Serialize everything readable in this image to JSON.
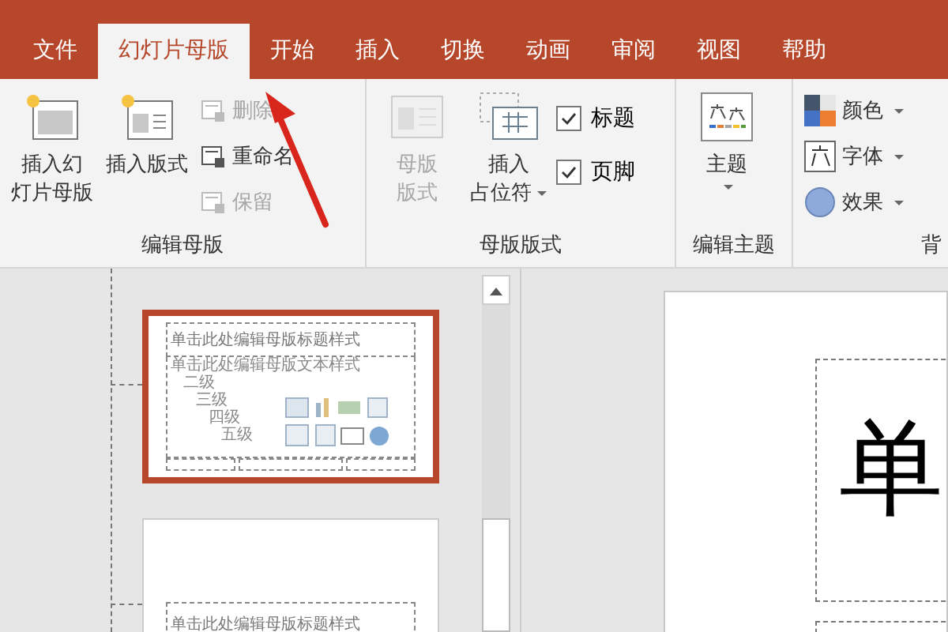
{
  "tabs": [
    {
      "label": "文件",
      "selected": false
    },
    {
      "label": "幻灯片母版",
      "selected": true
    },
    {
      "label": "开始",
      "selected": false
    },
    {
      "label": "插入",
      "selected": false
    },
    {
      "label": "切换",
      "selected": false
    },
    {
      "label": "动画",
      "selected": false
    },
    {
      "label": "审阅",
      "selected": false
    },
    {
      "label": "视图",
      "selected": false
    },
    {
      "label": "帮助",
      "selected": false
    }
  ],
  "ribbon": {
    "groups": [
      {
        "label": "编辑母版",
        "large_buttons": [
          {
            "lines": [
              "插入幻",
              "灯片母版"
            ],
            "disabled": false
          },
          {
            "lines": [
              "插入版式"
            ],
            "disabled": false
          }
        ],
        "small_buttons": [
          {
            "label": "删除",
            "disabled": true
          },
          {
            "label": "重命名",
            "disabled": false
          },
          {
            "label": "保留",
            "disabled": true
          }
        ]
      },
      {
        "label": "母版版式",
        "large_buttons": [
          {
            "lines": [
              "母版",
              "版式"
            ],
            "disabled": true
          },
          {
            "lines": [
              "插入",
              "占位符"
            ],
            "disabled": false,
            "dropdown": true
          }
        ],
        "checkboxes": [
          {
            "label": "标题",
            "checked": true
          },
          {
            "label": "页脚",
            "checked": true
          }
        ]
      },
      {
        "label": "编辑主题",
        "large_buttons": [
          {
            "lines": [
              "主题"
            ],
            "disabled": false,
            "dropdown": true
          }
        ]
      },
      {
        "label": "背",
        "small_buttons": [
          {
            "label": "颜色",
            "disabled": false,
            "dropdown": true
          },
          {
            "label": "字体",
            "disabled": false,
            "dropdown": true
          },
          {
            "label": "效果",
            "disabled": false,
            "dropdown": true
          }
        ]
      }
    ]
  },
  "thumbnails": [
    {
      "selected": true,
      "title": "单击此处编辑母版标题样式",
      "body": [
        "单击此处编辑母版文本样式",
        "二级",
        "三级",
        "四级",
        "五级"
      ]
    },
    {
      "selected": false,
      "title": "单击此处编辑母版标题样式"
    }
  ],
  "slide": {
    "title": "单"
  }
}
